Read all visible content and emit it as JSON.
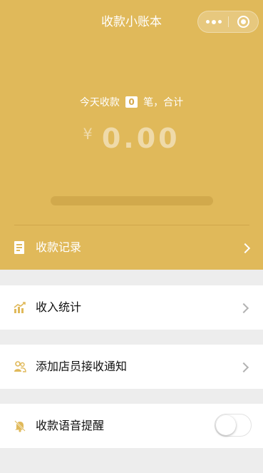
{
  "nav": {
    "title": "收款小账本",
    "more_icon": "more-dots-icon",
    "close_icon": "close-target-icon"
  },
  "summary": {
    "prefix": "今天收款",
    "count": "0",
    "suffix": "笔，合计",
    "currency": "¥",
    "amount": "0.00",
    "progress": 0
  },
  "records": {
    "label": "收款记录",
    "icon": "document-icon"
  },
  "menu": {
    "income_stats": {
      "label": "收入统计",
      "icon": "chart-icon"
    },
    "add_staff": {
      "label": "添加店员接收通知",
      "icon": "staff-icon"
    },
    "voice_alert": {
      "label": "收款语音提醒",
      "icon": "bell-icon",
      "enabled": false
    }
  },
  "colors": {
    "accent": "#e0b95a",
    "background": "#ededed",
    "text": "#111111"
  }
}
